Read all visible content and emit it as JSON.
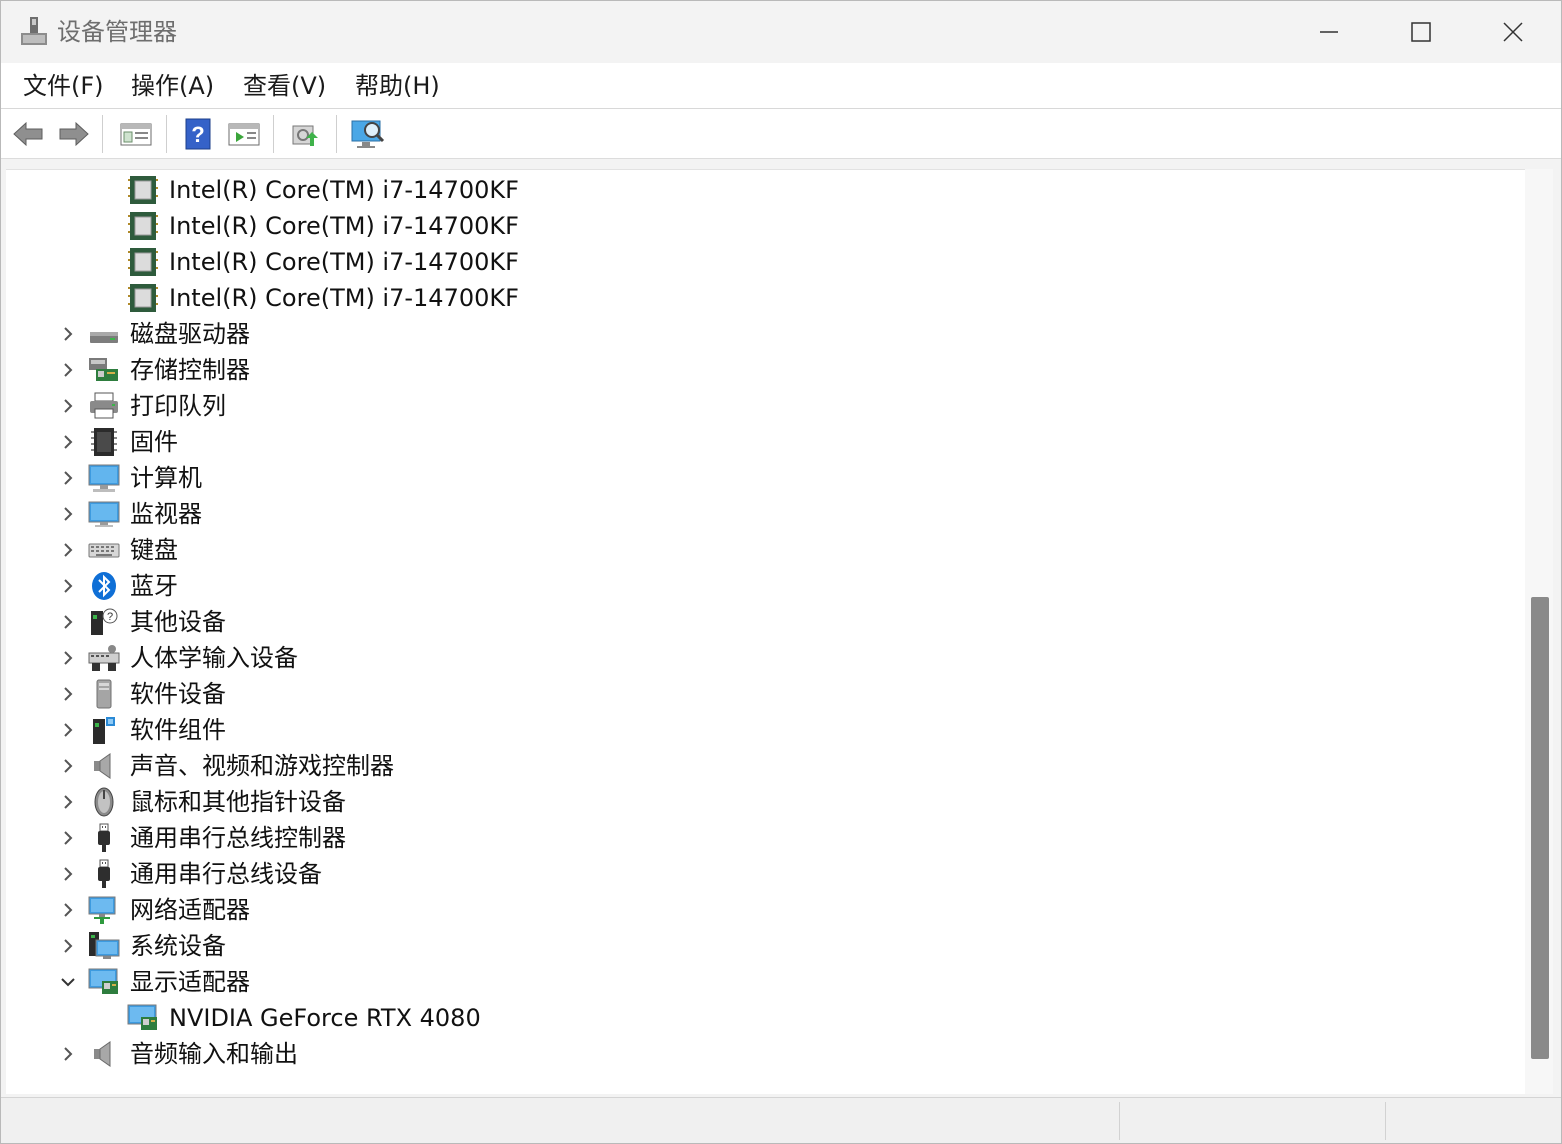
{
  "window": {
    "title": "设备管理器"
  },
  "menu": {
    "file": "文件(F)",
    "action": "操作(A)",
    "view": "查看(V)",
    "help": "帮助(H)"
  },
  "toolbar": {
    "icons": [
      "back-arrow-icon",
      "forward-arrow-icon",
      "properties-icon",
      "help-icon",
      "run-icon",
      "update-driver-icon",
      "scan-hardware-icon"
    ]
  },
  "tree": {
    "processors": [
      "Intel(R) Core(TM) i7-14700KF",
      "Intel(R) Core(TM) i7-14700KF",
      "Intel(R) Core(TM) i7-14700KF",
      "Intel(R) Core(TM) i7-14700KF"
    ],
    "categories": [
      "磁盘驱动器",
      "存储控制器",
      "打印队列",
      "固件",
      "计算机",
      "监视器",
      "键盘",
      "蓝牙",
      "其他设备",
      "人体学输入设备",
      "软件设备",
      "软件组件",
      "声音、视频和游戏控制器",
      "鼠标和其他指针设备",
      "通用串行总线控制器",
      "通用串行总线设备",
      "网络适配器",
      "系统设备",
      "显示适配器"
    ],
    "display_child": "NVIDIA GeForce RTX 4080",
    "last_category": "音频输入和输出"
  },
  "colors": {
    "accent": "#2f9be0",
    "chip": "#3a6b4a",
    "scroll_thumb": "#8a8a8a"
  }
}
